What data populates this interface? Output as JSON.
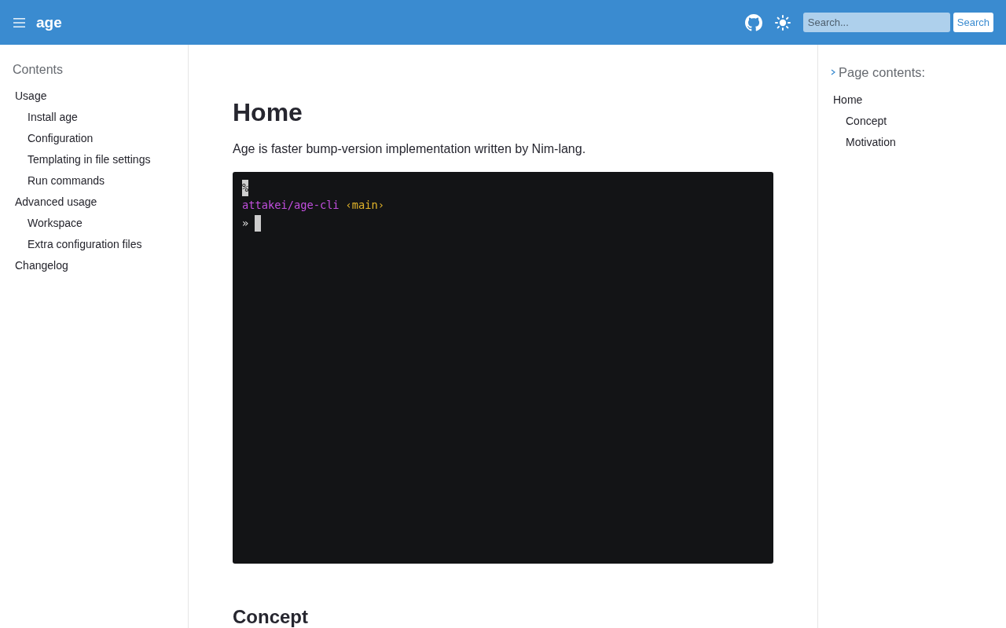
{
  "header": {
    "title": "age",
    "search": {
      "placeholder": "Search...",
      "button": "Search"
    }
  },
  "sidebar": {
    "title": "Contents",
    "items": [
      {
        "label": "Usage",
        "children": [
          {
            "label": "Install age"
          },
          {
            "label": "Configuration"
          },
          {
            "label": "Templating in file settings"
          },
          {
            "label": "Run commands"
          }
        ]
      },
      {
        "label": "Advanced usage",
        "children": [
          {
            "label": "Workspace"
          },
          {
            "label": "Extra configuration files"
          }
        ]
      },
      {
        "label": "Changelog"
      }
    ]
  },
  "main": {
    "heading": "Home",
    "intro": "Age is faster bump-version implementation written by Nim-lang.",
    "terminal": {
      "lines": [
        {
          "cursor": false,
          "segments": [
            {
              "text": "%",
              "color": "#1c1c1c",
              "highlighted": true
            }
          ]
        },
        {
          "cursor": false,
          "segments": [
            {
              "text": "attakei/age-cli",
              "color": "#c34fe0",
              "highlighted": false
            },
            {
              "text": "‹main›",
              "color": "#e3b52a",
              "highlighted": false
            }
          ]
        },
        {
          "cursor": true,
          "segments": [
            {
              "text": "»",
              "highlighted": false
            }
          ]
        }
      ]
    },
    "next_heading": "Concept"
  },
  "toc": {
    "title": "Page contents:",
    "items": [
      {
        "label": "Home",
        "children": [
          {
            "label": "Concept"
          },
          {
            "label": "Motivation"
          }
        ]
      }
    ]
  }
}
